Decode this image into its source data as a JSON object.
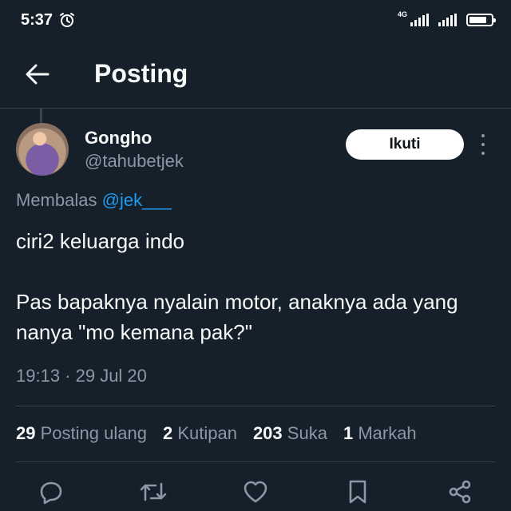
{
  "status_bar": {
    "time": "5:37",
    "network_label": "4G",
    "icons": [
      "alarm-icon",
      "signal-4g-icon",
      "signal-icon",
      "battery-icon"
    ]
  },
  "header": {
    "title": "Posting",
    "back_icon": "arrow-left-icon"
  },
  "post": {
    "author": {
      "display_name": "Gongho",
      "handle": "@tahubetjek",
      "avatar": "avatar-image"
    },
    "follow_label": "Ikuti",
    "more_icon": "more-vertical-icon",
    "reply_prefix": "Membalas",
    "reply_mention": "@jek___",
    "text_line1": "ciri2 keluarga indo",
    "text_line2": "Pas bapaknya nyalain motor, anaknya ada yang nanya \"mo kemana pak?\"",
    "timestamp": "19:13 · 29 Jul 20"
  },
  "stats": [
    {
      "value": "29",
      "label": "Posting ulang"
    },
    {
      "value": "2",
      "label": "Kutipan"
    },
    {
      "value": "203",
      "label": "Suka"
    },
    {
      "value": "1",
      "label": "Markah"
    }
  ],
  "actions": [
    "reply-icon",
    "repost-icon",
    "like-icon",
    "bookmark-icon",
    "share-icon"
  ],
  "colors": {
    "background": "#15202b",
    "text_primary": "#f7f9f9",
    "text_secondary": "#8b98a5",
    "accent": "#1d9bf0",
    "divider": "#38444d"
  }
}
